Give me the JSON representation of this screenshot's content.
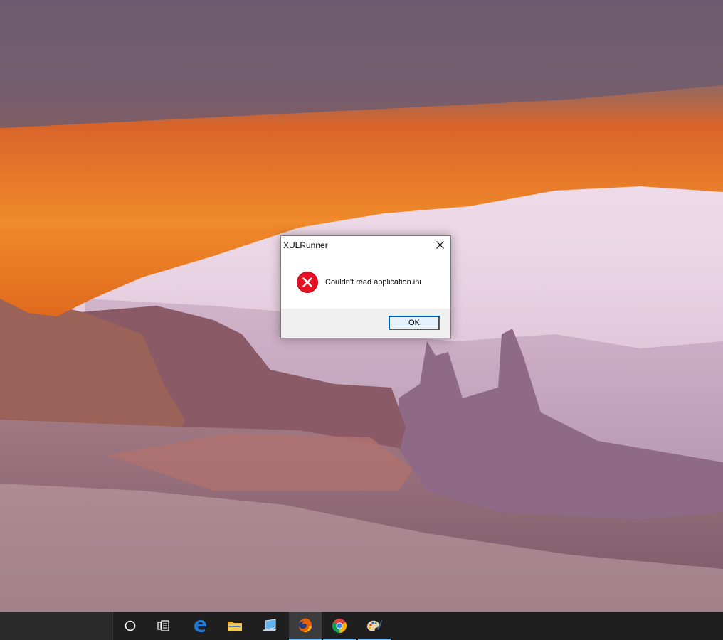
{
  "dialog": {
    "title": "XULRunner",
    "message": "Couldn't read application.ini",
    "ok_label": "OK",
    "icon": "error-icon"
  },
  "taskbar": {
    "items": [
      {
        "name": "cortana-search",
        "icon": "circle-icon"
      },
      {
        "name": "task-view",
        "icon": "task-view-icon"
      },
      {
        "name": "edge",
        "icon": "edge-icon"
      },
      {
        "name": "file-explorer",
        "icon": "folder-icon"
      },
      {
        "name": "this-pc",
        "icon": "laptop-icon"
      },
      {
        "name": "firefox",
        "icon": "firefox-icon",
        "active": true
      },
      {
        "name": "chrome",
        "icon": "chrome-icon",
        "running": true
      },
      {
        "name": "paint",
        "icon": "paint-icon",
        "running": true
      }
    ],
    "colors": {
      "background": "#1f1f20",
      "running_indicator": "#76b9ed"
    }
  },
  "colors": {
    "error_red": "#e81123",
    "focus_blue": "#0078d7"
  }
}
